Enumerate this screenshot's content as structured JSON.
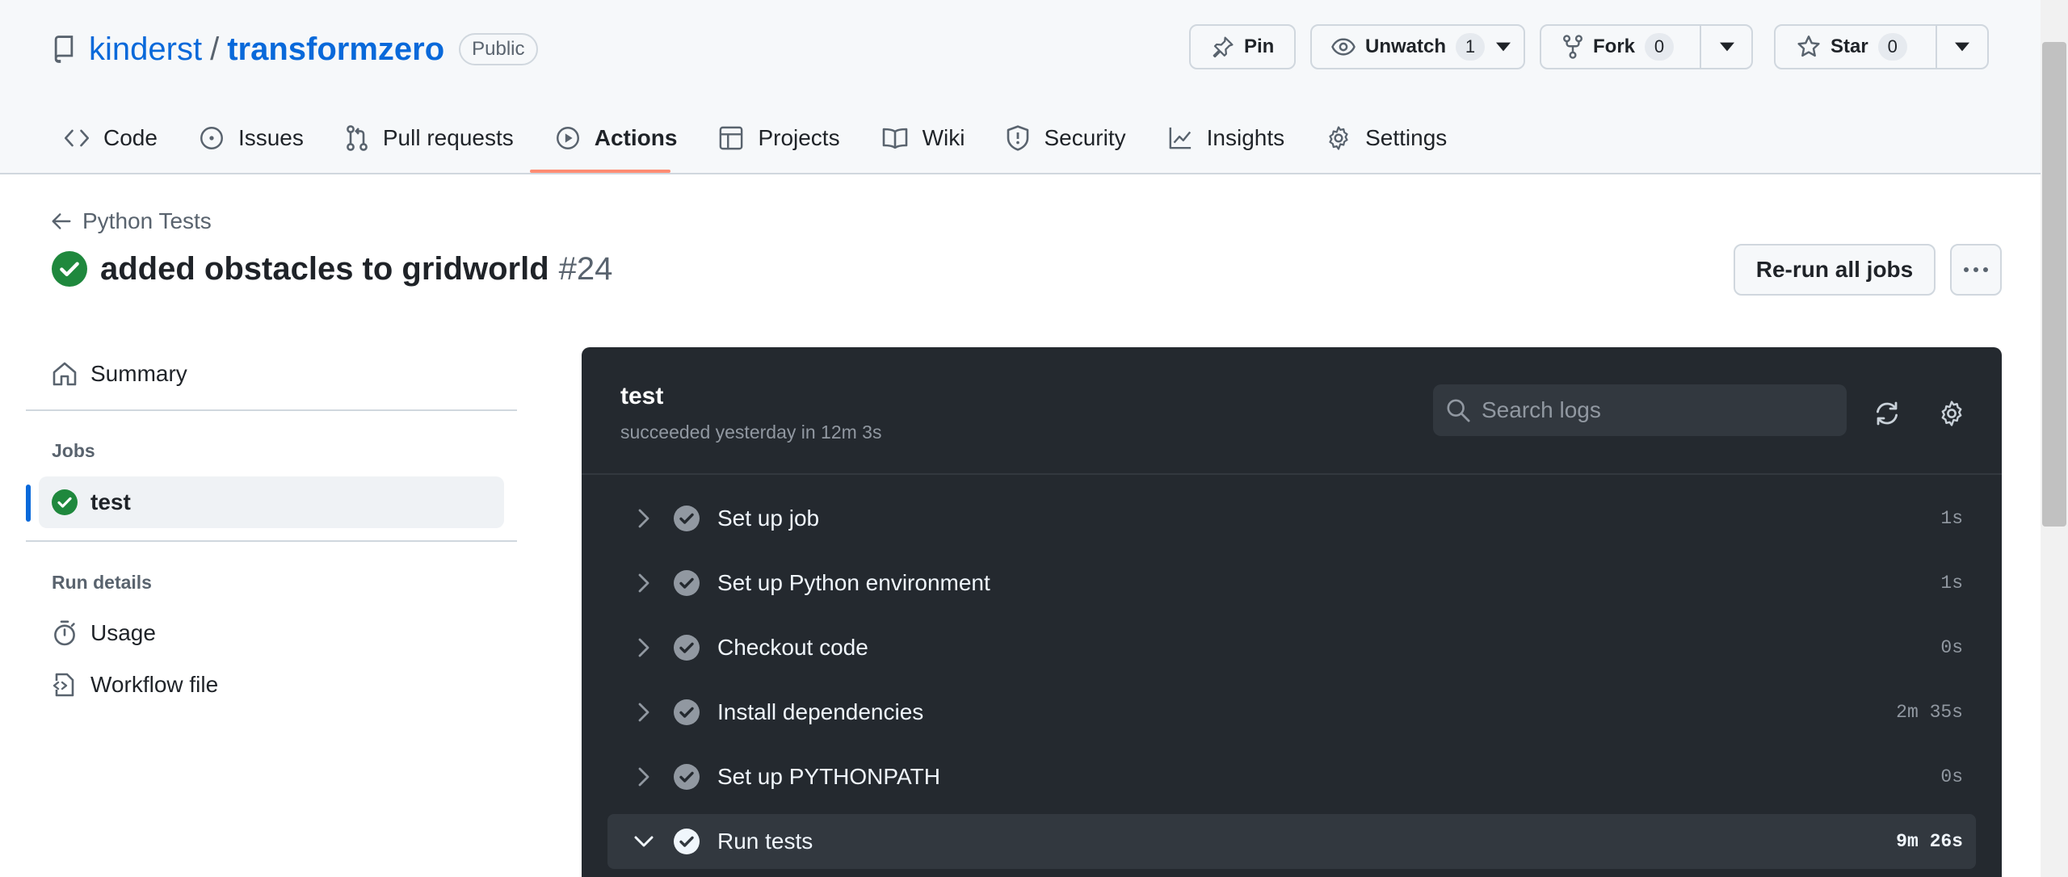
{
  "repo": {
    "owner": "kinderst",
    "separator": "/",
    "name": "transformzero",
    "visibility": "Public"
  },
  "actions": {
    "pin": "Pin",
    "unwatch": "Unwatch",
    "unwatch_count": "1",
    "fork": "Fork",
    "fork_count": "0",
    "star": "Star",
    "star_count": "0"
  },
  "nav": [
    {
      "label": "Code",
      "icon": "code-icon"
    },
    {
      "label": "Issues",
      "icon": "issue-icon"
    },
    {
      "label": "Pull requests",
      "icon": "pull-request-icon"
    },
    {
      "label": "Actions",
      "icon": "play-icon",
      "active": true
    },
    {
      "label": "Projects",
      "icon": "table-icon"
    },
    {
      "label": "Wiki",
      "icon": "book-icon"
    },
    {
      "label": "Security",
      "icon": "shield-icon"
    },
    {
      "label": "Insights",
      "icon": "graph-icon"
    },
    {
      "label": "Settings",
      "icon": "gear-icon"
    }
  ],
  "run": {
    "back_label": "Python Tests",
    "title": "added obstacles to gridworld",
    "number": "#24",
    "rerun_label": "Re-run all jobs"
  },
  "sidebar": {
    "summary": "Summary",
    "jobs_heading": "Jobs",
    "job": "test",
    "run_details_heading": "Run details",
    "usage": "Usage",
    "workflow_file": "Workflow file"
  },
  "log": {
    "job_name": "test",
    "status": "succeeded yesterday in 12m 3s",
    "search_placeholder": "Search logs",
    "steps": [
      {
        "name": "Set up job",
        "duration": "1s"
      },
      {
        "name": "Set up Python environment",
        "duration": "1s"
      },
      {
        "name": "Checkout code",
        "duration": "0s"
      },
      {
        "name": "Install dependencies",
        "duration": "2m 35s"
      },
      {
        "name": "Set up PYTHONPATH",
        "duration": "0s"
      },
      {
        "name": "Run tests",
        "duration": "9m 26s",
        "expanded": true
      }
    ]
  },
  "colors": {
    "link": "#0969da",
    "success": "#1f883d",
    "active_tab_underline": "#fd8c73",
    "log_bg": "#24292f"
  }
}
